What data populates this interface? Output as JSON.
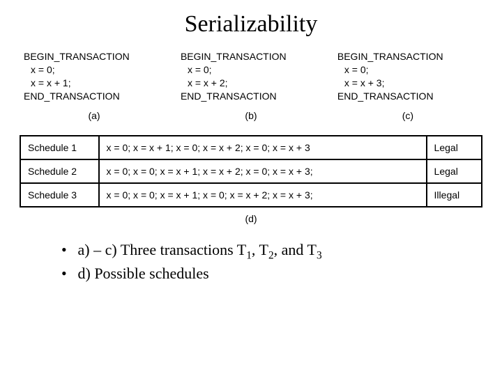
{
  "title": "Serializability",
  "transactions": [
    {
      "begin": "BEGIN_TRANSACTION",
      "line1": "x = 0;",
      "line2": "x = x + 1;",
      "end": "END_TRANSACTION",
      "label": "(a)"
    },
    {
      "begin": "BEGIN_TRANSACTION",
      "line1": "x = 0;",
      "line2": "x = x + 2;",
      "end": "END_TRANSACTION",
      "label": "(b)"
    },
    {
      "begin": "BEGIN_TRANSACTION",
      "line1": "x = 0;",
      "line2": "x = x + 3;",
      "end": "END_TRANSACTION",
      "label": "(c)"
    }
  ],
  "schedules": [
    {
      "name": "Schedule 1",
      "ops": "x = 0;  x = x + 1;  x = 0;  x = x + 2;  x = 0;  x = x + 3",
      "result": "Legal"
    },
    {
      "name": "Schedule 2",
      "ops": "x = 0;   x = 0;  x = x + 1;  x = x + 2;  x = 0;  x = x + 3;",
      "result": "Legal"
    },
    {
      "name": "Schedule 3",
      "ops": "x = 0;  x = 0;  x = x + 1;  x = 0;  x = x + 2;  x = x + 3;",
      "result": "Illegal"
    }
  ],
  "d_label": "(d)",
  "bullets": {
    "line1_pre": "a) – c) Three transactions T",
    "line1_s1": "1",
    "line1_mid1": ", T",
    "line1_s2": "2",
    "line1_mid2": ", and T",
    "line1_s3": "3",
    "line2": "d) Possible schedules"
  }
}
